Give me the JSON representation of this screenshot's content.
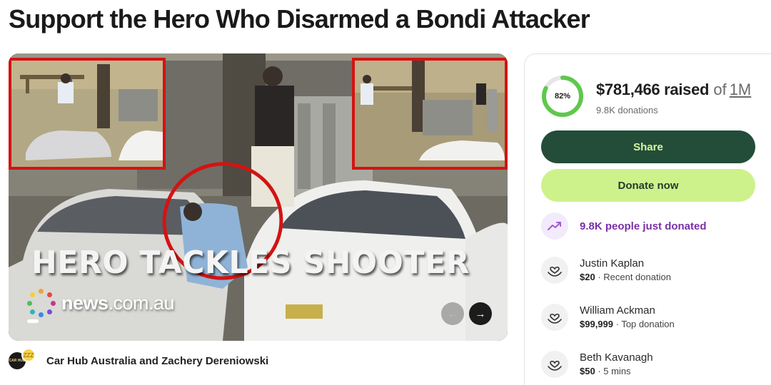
{
  "page": {
    "title": "Support the Hero Who Disarmed a Bondi Attacker"
  },
  "media": {
    "caption": "HERO TACKLES SHOOTER",
    "brand_name": "news",
    "brand_tld": ".com.au",
    "prev_icon": "arrow-left-icon",
    "next_icon": "arrow-right-icon",
    "prev_glyph": "←",
    "next_glyph": "→",
    "highlight_color": "#d31313"
  },
  "organizer": {
    "name": "Car Hub Australia and Zachery Dereniowski",
    "avatar_text": "CAR HUB",
    "badge_text": "ZZZ"
  },
  "campaign": {
    "percent_label": "82%",
    "progress": 0.82,
    "raised_amount": "$781,466 raised",
    "of_word": "of",
    "goal": "1M",
    "donations_count": "9.8K donations",
    "ring_color": "#5fc84c",
    "ring_track_color": "#e6e6e6"
  },
  "actions": {
    "share_label": "Share",
    "donate_label": "Donate now",
    "share_color": "#234d39",
    "donate_color": "#cdf28c"
  },
  "activity": {
    "trend_text": "9.8K people just donated",
    "trend_color": "#7a2fa8"
  },
  "donors": [
    {
      "name": "Justin Kaplan",
      "amount": "$20",
      "detail": " · Recent donation"
    },
    {
      "name": "William Ackman",
      "amount": "$99,999",
      "detail": " · Top donation"
    },
    {
      "name": "Beth Kavanagh",
      "amount": "$50",
      "detail": " · 5 mins"
    }
  ]
}
